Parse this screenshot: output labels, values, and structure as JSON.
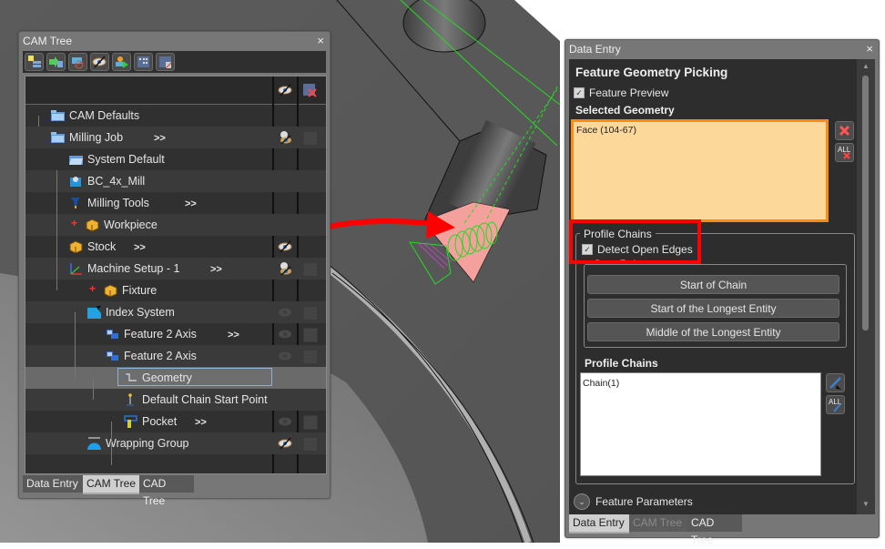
{
  "viewport": {
    "colors": {
      "highlight_face": "#f4a09c",
      "toolpath": "#22dd22",
      "toolpath_alt": "#c040c0",
      "annotation_arrow": "#ff0000"
    }
  },
  "cam_tree": {
    "title": "CAM Tree",
    "close_icon": "×",
    "toolbar": [
      "new-job-icon",
      "import-icon",
      "hide-tool-icon",
      "visibility-icon",
      "simulate-icon",
      "grid-icon",
      "grid-settings-icon"
    ],
    "header_icons": [
      "visibility-icon",
      "clear-all-icon"
    ],
    "rows": [
      {
        "label": "CAM Defaults",
        "icon": "folder-icon",
        "more": "",
        "visibility": "",
        "lock": false
      },
      {
        "label": "Milling Job",
        "icon": "folder-icon",
        "more": ">>",
        "visibility": "mixed",
        "lock": true
      },
      {
        "label": "System Default",
        "icon": "folder-open-icon",
        "more": "",
        "visibility": "",
        "lock": false
      },
      {
        "label": "BC_4x_Mill",
        "icon": "machine-icon",
        "more": "",
        "visibility": "",
        "lock": false
      },
      {
        "label": "Milling Tools",
        "icon": "tool-icon",
        "more": ">>",
        "visibility": "",
        "lock": false
      },
      {
        "label": "Workpiece",
        "icon": "box-icon",
        "more": "",
        "visibility": "",
        "lock": false
      },
      {
        "label": "Stock",
        "icon": "box-icon",
        "more": ">>",
        "visibility": "hidden",
        "lock": false
      },
      {
        "label": "Machine Setup - 1",
        "icon": "axes-icon",
        "more": ">>",
        "visibility": "mixed",
        "lock": true
      },
      {
        "label": "Fixture",
        "icon": "box-icon",
        "more": "",
        "visibility": "",
        "lock": false
      },
      {
        "label": "Index System",
        "icon": "index-system-icon",
        "more": "",
        "visibility": "dim",
        "lock": true
      },
      {
        "label": "Feature 2 Axis",
        "icon": "feature-icon",
        "more": ">>",
        "visibility": "dim",
        "lock": true
      },
      {
        "label": "Feature 2 Axis",
        "icon": "feature-icon",
        "more": "",
        "visibility": "dim",
        "lock": true
      },
      {
        "label": "Geometry",
        "icon": "geometry-icon",
        "more": "",
        "visibility": "",
        "lock": false,
        "selected": true
      },
      {
        "label": "Default Chain Start Point",
        "icon": "start-point-icon",
        "more": "",
        "visibility": "",
        "lock": false
      },
      {
        "label": "Pocket",
        "icon": "pocket-icon",
        "more": ">>",
        "visibility": "dim",
        "lock": true
      },
      {
        "label": "Wrapping Group",
        "icon": "wrapping-icon",
        "more": "",
        "visibility": "hidden",
        "lock": true
      }
    ],
    "tabs": [
      {
        "label": "Data Entry",
        "active": false
      },
      {
        "label": "CAM Tree",
        "active": true
      },
      {
        "label": "CAD Tree",
        "active": false
      }
    ]
  },
  "data_entry": {
    "title": "Data Entry",
    "close_icon": "×",
    "heading": "Feature Geometry Picking",
    "feature_preview": {
      "label": "Feature Preview",
      "checked": true
    },
    "selected_geometry": {
      "label": "Selected Geometry",
      "items": [
        "Face (104-67)"
      ]
    },
    "profile_chains_group": {
      "legend": "Profile Chains",
      "detect_open_edges": {
        "label": "Detect Open Edges",
        "checked": true
      },
      "start_point_label": "Start Point",
      "buttons": [
        "Start of Chain",
        "Start of the Longest Entity",
        "Middle of the Longest Entity"
      ]
    },
    "profile_chains_list": {
      "label": "Profile Chains",
      "items": [
        "Chain(1)"
      ]
    },
    "feature_parameters": "Feature Parameters",
    "tabs": [
      {
        "label": "Data Entry",
        "active": true
      },
      {
        "label": "CAM Tree",
        "active": false,
        "disabled": true
      },
      {
        "label": "CAD Tree",
        "active": false
      }
    ]
  }
}
